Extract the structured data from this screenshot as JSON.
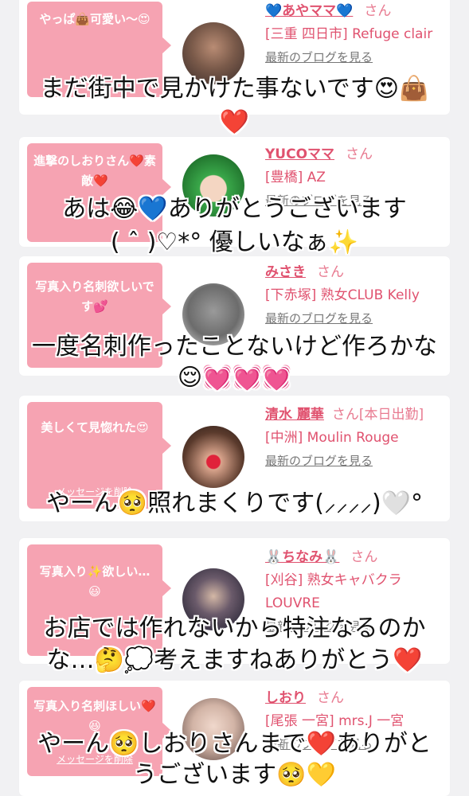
{
  "cards": [
    {
      "bubble": "やっぱ👜可愛い〜😍",
      "name": "💙あやママ💙",
      "suffix": "さん",
      "location": "[三重 四日市] Refuge clair",
      "blog": "最新のブログを見る",
      "delete": ""
    },
    {
      "bubble": "進撃のしおりさん❤️素敵❤️",
      "name": "YUCOママ",
      "suffix": "さん",
      "location": "[豊橋] AZ",
      "blog": "最新のブログを見る",
      "delete": ""
    },
    {
      "bubble": "写真入り名刺欲しいです💕",
      "name": "みさき",
      "suffix": "さん",
      "location": "[下赤塚] 熟女CLUB Kelly",
      "blog": "最新のブログを見る",
      "delete": ""
    },
    {
      "bubble": "美しくて見惚れた😍",
      "name": "清水 麗華",
      "suffix": "さん[本日出勤]",
      "location": "[中洲] Moulin Rouge",
      "blog": "最新のブログを見る",
      "delete": "メッセージを削除"
    },
    {
      "bubble": "写真入り✨欲しい…😃",
      "name": "🐰ちなみ🐰",
      "suffix": "さん",
      "location": "[刈谷] 熟女キャバクラ LOUVRE",
      "blog": "最新のブログを見る",
      "delete": ""
    },
    {
      "bubble": "写真入り名刺ほしい❤️😆",
      "name": "しおり",
      "suffix": "さん",
      "location": "[尾張 一宮] mrs.J 一宮",
      "blog": "最新のブログを見る",
      "delete": "メッセージを削除"
    }
  ],
  "overlays": [
    "まだ街中で見かけた事ないです😍👜",
    "❤️",
    "あは😂💙ありがとうございます",
    "( ˆ )♡*° 優しいなぁ✨",
    "一度名刺作ったことないけど作ろかな",
    "😌💓💓💓",
    "やーん🥺照れまくりです(⸝⸝⸝⸝)🤍°",
    "お店では作れないから特注なるのか",
    "な…🤔💭考えますねありがとう❤️",
    "やーん🥺しおりさんまで❤️ありがと",
    "うございます🥺💛"
  ],
  "colors": {
    "accent": "#e0526f",
    "bubble": "#f6a3b2",
    "background": "#f1f1f3"
  }
}
